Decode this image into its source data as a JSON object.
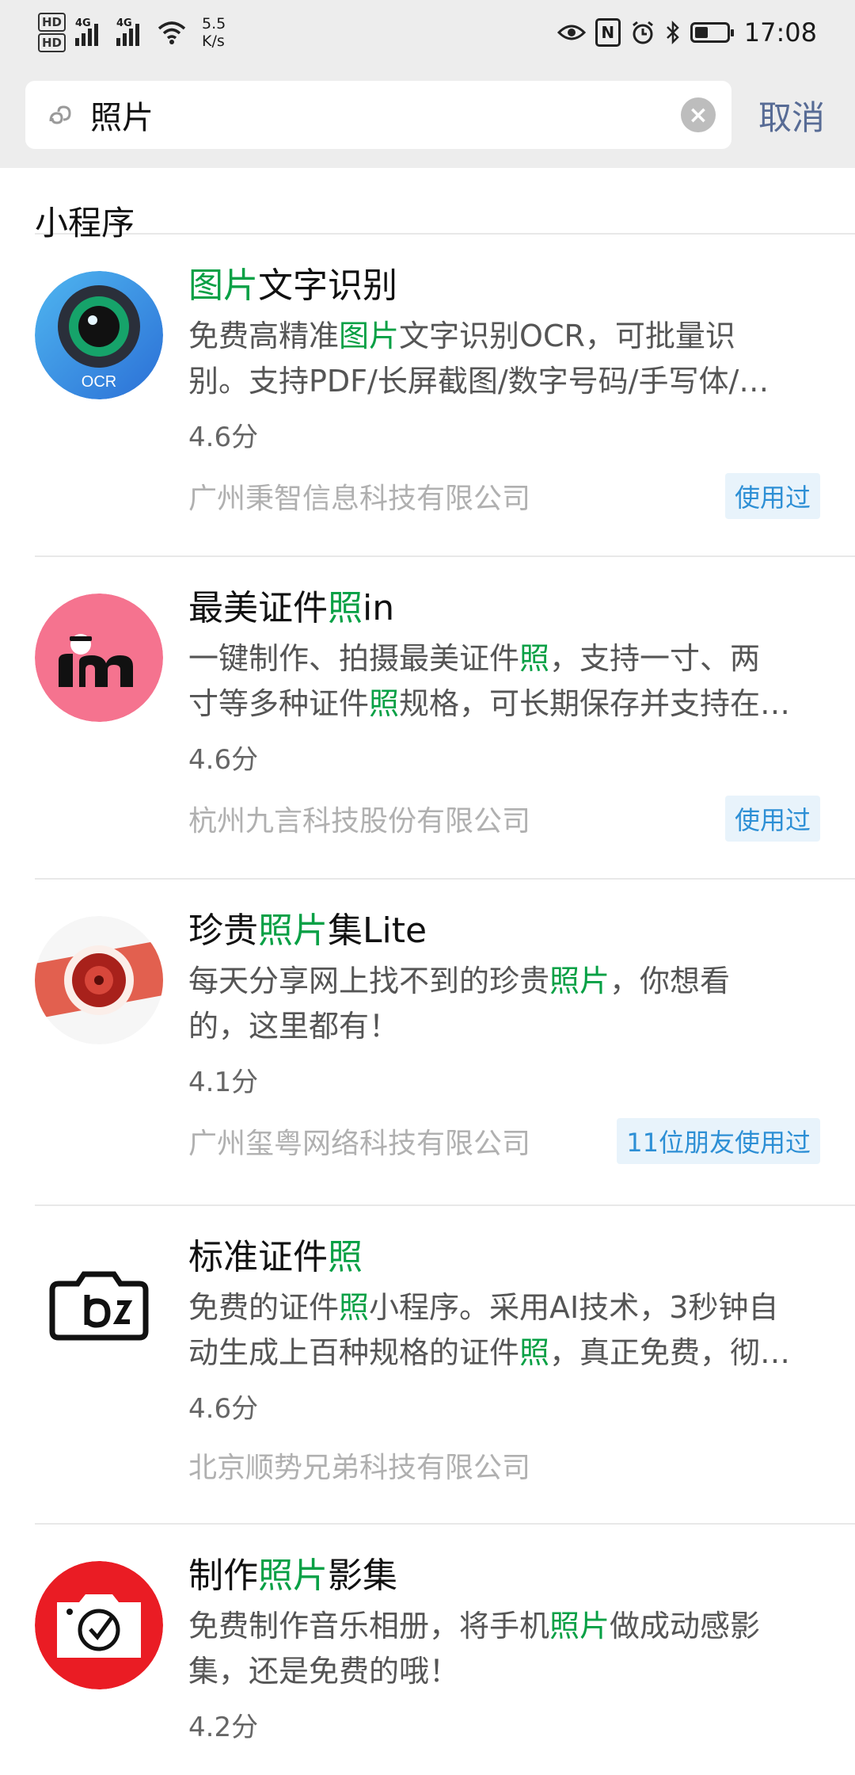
{
  "status_bar": {
    "hd1": "HD",
    "hd2": "HD",
    "sig1_tag": "4G",
    "sig2_tag": "4G",
    "net_speed_value": "5.5",
    "net_speed_unit": "K/s",
    "nfc": "N",
    "time": "17:08"
  },
  "search": {
    "query": "照片",
    "cancel_label": "取消"
  },
  "section": {
    "title": "小程序"
  },
  "items": [
    {
      "title": {
        "pre": "",
        "hl": "图片",
        "post": "文字识别"
      },
      "desc1": {
        "pre": "免费高精准",
        "hl": "图片",
        "post": "文字识别OCR，可批量识"
      },
      "desc2": {
        "pre": "别。支持PDF/长屏截图/数字号码/手写体/…",
        "hl": "",
        "post": ""
      },
      "score": "4.6分",
      "company": "广州秉智信息科技有限公司",
      "badge": "使用过",
      "icon_text": "OCR"
    },
    {
      "title": {
        "pre": "最美证件",
        "hl": "照",
        "post": "in"
      },
      "desc1": {
        "pre": "一键制作、拍摄最美证件",
        "hl": "照",
        "post": "，支持一寸、两"
      },
      "desc2": {
        "pre": "寸等多种证件",
        "hl": "照",
        "post": "规格，可长期保存并支持在…"
      },
      "score": "4.6分",
      "company": "杭州九言科技股份有限公司",
      "badge": "使用过"
    },
    {
      "title": {
        "pre": "珍贵",
        "hl": "照片",
        "post": "集Lite"
      },
      "desc1": {
        "pre": "每天分享网上找不到的珍贵",
        "hl": "照片",
        "post": "，你想看"
      },
      "desc2": {
        "pre": "的，这里都有！",
        "hl": "",
        "post": ""
      },
      "score": "4.1分",
      "company": "广州玺粤网络科技有限公司",
      "badge": "11位朋友使用过"
    },
    {
      "title": {
        "pre": "标准证件",
        "hl": "照",
        "post": ""
      },
      "desc1": {
        "pre": "免费的证件",
        "hl": "照",
        "post": "小程序。采用AI技术，3秒钟自"
      },
      "desc2": {
        "pre": "动生成上百种规格的证件",
        "hl": "照",
        "post": "，真正免费，彻…"
      },
      "score": "4.6分",
      "company": "北京顺势兄弟科技有限公司",
      "badge": ""
    },
    {
      "title": {
        "pre": "制作",
        "hl": "照片",
        "post": "影集"
      },
      "desc1": {
        "pre": "免费制作音乐相册，将手机",
        "hl": "照片",
        "post": "做成动感影"
      },
      "desc2": {
        "pre": "集，还是免费的哦！",
        "hl": "",
        "post": ""
      },
      "score": "4.2分",
      "company": "",
      "badge": ""
    }
  ]
}
